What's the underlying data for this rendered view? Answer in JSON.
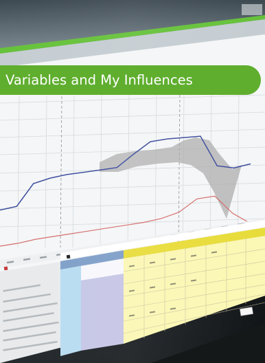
{
  "banner": {
    "title": "Variables and My Influences"
  },
  "chart_data": {
    "type": "line",
    "series": [
      {
        "values": [
          0.05,
          0.1,
          0.45,
          0.52,
          0.56,
          0.58,
          0.6,
          0.62,
          0.8,
          0.96,
          0.98,
          0.98,
          0.98,
          0.56,
          0.52,
          0.56
        ]
      },
      {
        "values": [
          0.0,
          0.02,
          0.06,
          0.08,
          0.1,
          0.12,
          0.14,
          0.16,
          0.18,
          0.22,
          0.3,
          0.5,
          0.52,
          0.2,
          0.0
        ]
      }
    ],
    "grid": true
  },
  "colors": {
    "accent": "#5fae2e",
    "upper_series": "#3a4a9c",
    "lower_series": "#d66a6a",
    "confidence_band": "#a8a8a8",
    "grid_header": "#e8dc3a",
    "input_cells": "#fbf7b4",
    "id_cells": "#b8dcf2",
    "meta_cells": "#c6c6e6",
    "monitor_bezel": "#1e2326"
  },
  "icons": [
    "close-icon"
  ]
}
